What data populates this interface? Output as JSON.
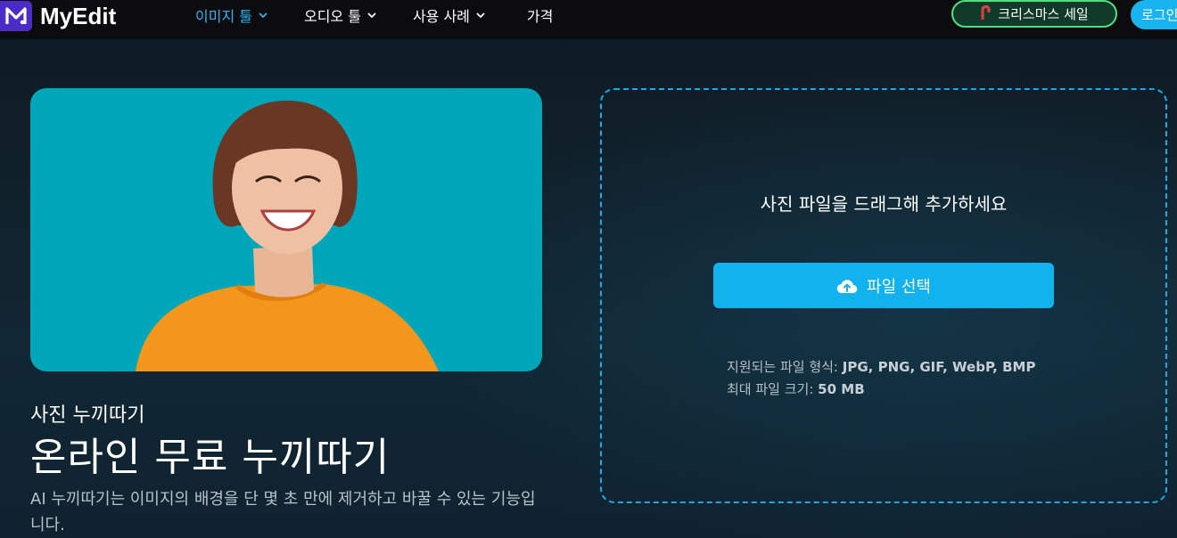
{
  "header": {
    "logo_text": "MyEdit",
    "nav": [
      {
        "label": "이미지 툴",
        "active": true,
        "has_dropdown": true
      },
      {
        "label": "오디오 툴",
        "active": false,
        "has_dropdown": true
      },
      {
        "label": "사용 사례",
        "active": false,
        "has_dropdown": true
      },
      {
        "label": "가격",
        "active": false,
        "has_dropdown": false
      }
    ],
    "promo_label": "크리스마스 세일",
    "login_label": "로그인"
  },
  "hero": {
    "kicker": "사진 누끼따기",
    "headline": "온라인 무료 누끼따기",
    "description": "AI 누끼따기는 이미지의 배경을 단 몇 초 만에 제거하고 바꿀 수 있는 기능입니다."
  },
  "upload": {
    "drop_text": "사진 파일을 드래그해 추가하세요",
    "button_label": "파일 선택",
    "formats_label": "지원되는 파일 형식:",
    "formats_value": "JPG, PNG, GIF, WebP, BMP",
    "maxsize_label": "최대 파일 크기:",
    "maxsize_value": "50 MB"
  },
  "colors": {
    "accent": "#12b2ef",
    "active_nav": "#2bb4f2",
    "promo_border": "#4ee07e",
    "hero_bg": "#01a6bb",
    "logo_bg": "#4b2cc9"
  },
  "icons": {
    "logo": "myedit-logo-icon",
    "nav_chevron": "chevron-down-icon",
    "promo": "candy-cane-icon",
    "upload": "cloud-upload-icon"
  }
}
